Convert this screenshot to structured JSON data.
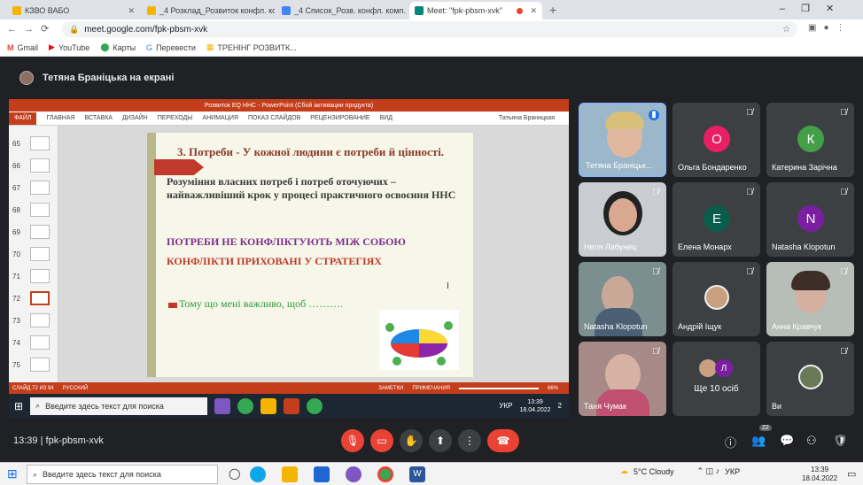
{
  "browser": {
    "tabs": [
      {
        "title": "КЗВО ВАБО",
        "color": "#f4b400"
      },
      {
        "title": "_4 Розклад_Розвиток конфл. ко",
        "color": "#f4b400"
      },
      {
        "title": "_4 Список_Розв. конфл. комп.",
        "color": "#4285f4"
      },
      {
        "title": "Meet: \"fpk-pbsm-xvk\"",
        "color": "#00897b",
        "active": true
      }
    ],
    "new_tab": "+",
    "url": "meet.google.com/fpk-pbsm-xvk",
    "bookmarks": [
      "Gmail",
      "YouTube",
      "Карты",
      "Перевести",
      "ТРЕНІНГ РОЗВИТК..."
    ]
  },
  "meet": {
    "presenter": "Тетяна Браніцька на екрані",
    "time": "13:39",
    "code": "fpk-pbsm-xvk",
    "participant_count": "22"
  },
  "ppt": {
    "window_title": "Розвиток EQ ННС -  PowerPoint (Сбой активации продукта)",
    "file_tab": "ФАЙЛ",
    "ribbon": [
      "ГЛАВНАЯ",
      "ВСТАВКА",
      "ДИЗАЙН",
      "ПЕРЕХОДЫ",
      "АНИМАЦИЯ",
      "ПОКАЗ СЛАЙДОВ",
      "РЕЦЕНЗИРОВАНИЕ",
      "ВИД"
    ],
    "user": "Татьяна Браницкая",
    "thumbs": [
      "65",
      "66",
      "67",
      "68",
      "69",
      "70",
      "71",
      "72",
      "73",
      "74",
      "75"
    ],
    "selected_thumb": "72",
    "status_slide": "СЛАЙД 72 ИЗ 94",
    "status_lang": "РУССКИЙ",
    "status_notes": "ЗАМЕТКИ",
    "status_comments": "ПРИМЕЧАНИЯ",
    "zoom": "66%",
    "slide": {
      "heading": "3. Потреби - У кожної людини є потреби й цінності.",
      "body": "Розуміння власних потреб і потреб оточуючих – найважливіший крок у процесі практичного освоєння ННС",
      "line1": "ПОТРЕБИ НЕ КОНФЛІКТУЮТЬ  МІЖ СОБОЮ",
      "line2": "КОНФЛІКТИ ПРИХОВАНІ У СТРАТЕГІЯХ",
      "bullet": "Тому що мені важливо, щоб ………."
    },
    "taskbar_search": "Введите здесь текст для поиска",
    "tray_lang": "УКР",
    "tray_time": "13:39",
    "tray_date": "18.04.2022",
    "notif": "2"
  },
  "tiles": [
    {
      "name": "Тетяна Браніцьк...",
      "type": "video",
      "bg": "#9bb7c9",
      "speaking": true
    },
    {
      "name": "Ольга Бондаренко",
      "letter": "О",
      "color": "#e91e63"
    },
    {
      "name": "Катерина Зарічна",
      "letter": "К",
      "color": "#43a047"
    },
    {
      "name": "Неля Лабунец",
      "type": "video",
      "bg": "#c9ccd0"
    },
    {
      "name": "Елена Монарх",
      "letter": "Е",
      "color": "#0b5d4b"
    },
    {
      "name": "Natasha Klopotun",
      "letter": "N",
      "color": "#7b1fa2"
    },
    {
      "name": "Natasha Klopotun",
      "type": "video",
      "bg": "#7b8f91"
    },
    {
      "name": "Андрій Іщук",
      "type": "photo",
      "bg": "#3c4043"
    },
    {
      "name": "Анна Кравчук",
      "type": "video",
      "bg": "#b7bdb7"
    },
    {
      "name": "Таня Чумак",
      "type": "video",
      "bg": "#a78a88"
    },
    {
      "name": "Ще 10 осіб",
      "type": "more",
      "bg": "#3c4043"
    },
    {
      "name": "Ви",
      "type": "photo",
      "bg": "#3c4043"
    }
  ],
  "more_letter": "Л",
  "taskbar": {
    "search": "Введите здесь текст для поиска",
    "weather": "5°C  Cloudy",
    "lang": "УКР",
    "time": "13:39",
    "date": "18.04.2022"
  }
}
